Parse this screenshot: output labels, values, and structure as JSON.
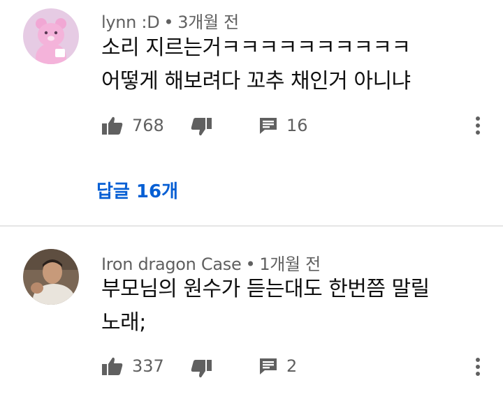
{
  "comments": [
    {
      "author": "lynn :D",
      "time": "3개월 전",
      "text_line1": "소리 지르는거ㅋㅋㅋㅋㅋㅋㅋㅋㅋㅋ",
      "text_line2": "어떻게 해보려다 꼬추 채인거 아니냐",
      "likes": "768",
      "replies_count": "16",
      "replies_link": "답글 16개"
    },
    {
      "author": "Iron dragon Case",
      "time": "1개월 전",
      "text_line1": "부모님의 원수가 듣는대도 한번쯤 말릴",
      "text_line2": "노래;",
      "likes": "337",
      "replies_count": "2"
    }
  ],
  "separator": "•",
  "colors": {
    "text_primary": "#0f0f0f",
    "text_secondary": "#606060",
    "link_blue": "#065fd4",
    "divider": "#e5e5e5",
    "avatar1_bg": "#e6cbe4"
  },
  "icons": [
    "like-icon",
    "dislike-icon",
    "reply-icon",
    "more-icon"
  ]
}
